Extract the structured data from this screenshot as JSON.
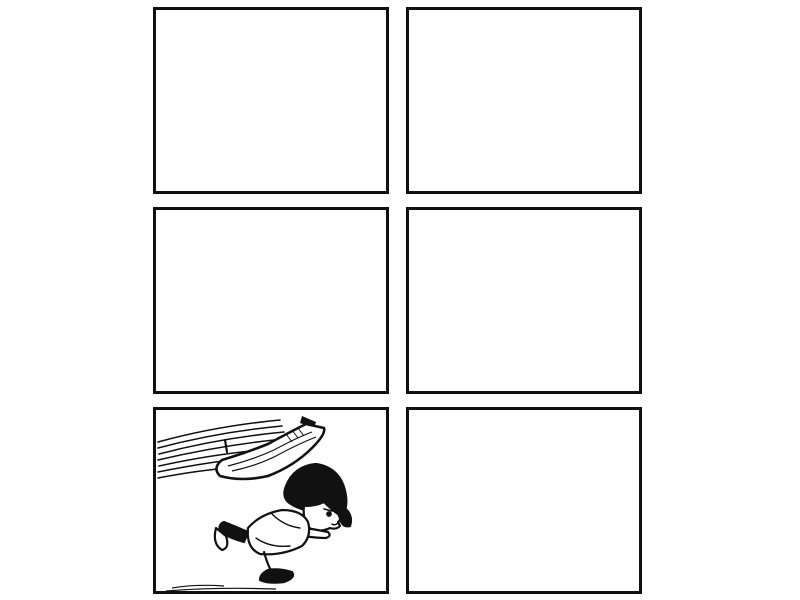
{
  "panels": [
    {
      "content": "empty"
    },
    {
      "content": "empty"
    },
    {
      "content": "empty"
    },
    {
      "content": "empty"
    },
    {
      "content": "girl-running-under-swing-seat"
    },
    {
      "content": "empty"
    }
  ],
  "colors": {
    "ink": "#111111",
    "paper": "#ffffff"
  }
}
